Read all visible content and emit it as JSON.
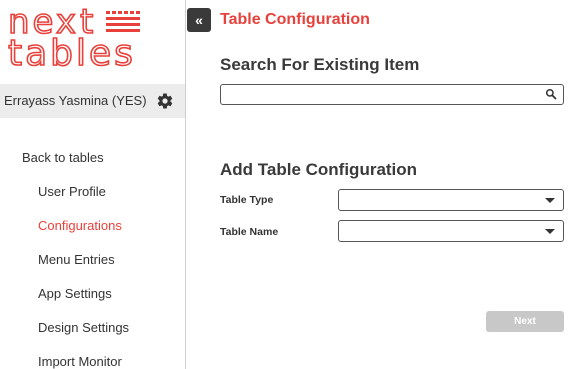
{
  "logo": {
    "line1": "next",
    "line2": "tables"
  },
  "user": {
    "name": "Errayass Yasmina (YES)",
    "settings_icon": "gear-icon"
  },
  "sidebar": {
    "items": [
      {
        "label": "Back to tables",
        "active": false
      },
      {
        "label": "User Profile",
        "active": false
      },
      {
        "label": "Configurations",
        "active": true
      },
      {
        "label": "Menu Entries",
        "active": false
      },
      {
        "label": "App Settings",
        "active": false
      },
      {
        "label": "Design Settings",
        "active": false
      },
      {
        "label": "Import Monitor",
        "active": false
      }
    ]
  },
  "collapse_button": {
    "label": "«"
  },
  "page": {
    "title": "Table Configuration"
  },
  "search": {
    "heading": "Search For Existing Item",
    "value": "",
    "icon": "search-icon"
  },
  "add": {
    "heading": "Add Table Configuration",
    "table_type_label": "Table Type",
    "table_type_value": "",
    "table_name_label": "Table Name",
    "table_name_value": ""
  },
  "next_button": {
    "label": "Next",
    "enabled": false
  },
  "colors": {
    "accent": "#e8413b",
    "dark": "#3a3a3a",
    "disabled": "#c8c8c8",
    "sidebar_user_bg": "#ececec"
  }
}
